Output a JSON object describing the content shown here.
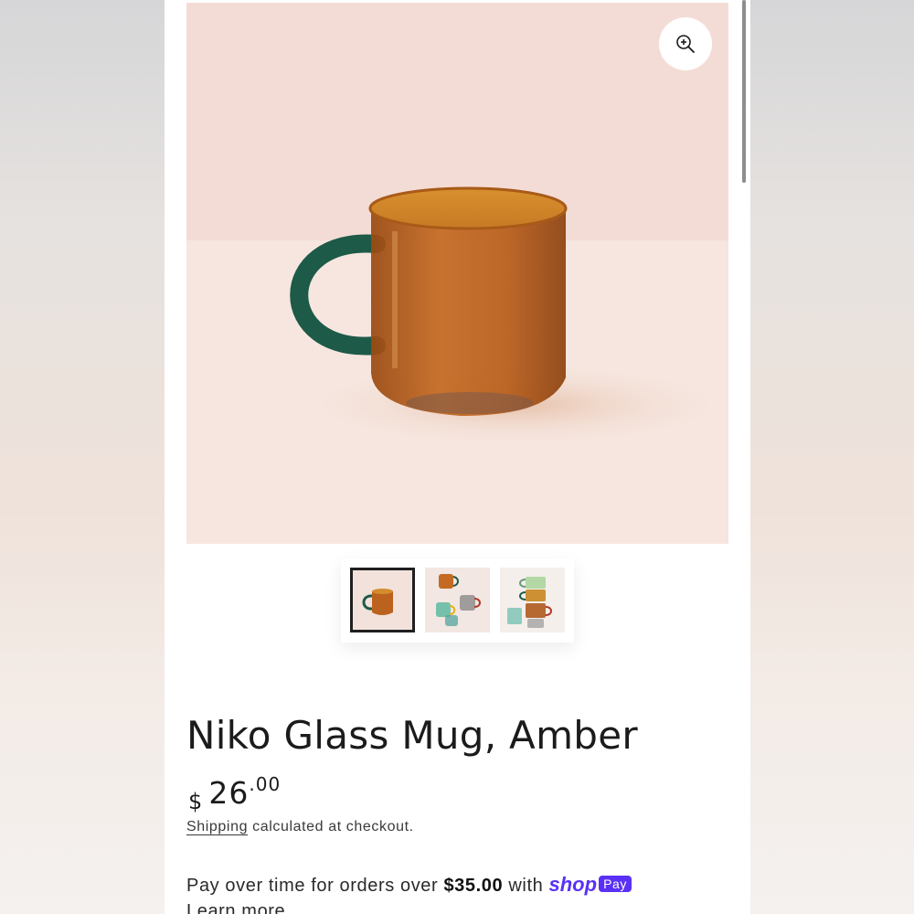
{
  "gallery": {
    "zoom_icon": "zoom-in-icon",
    "thumbnails": [
      {
        "name": "amber-mug-thumb",
        "active": true
      },
      {
        "name": "mugs-group-thumb",
        "active": false
      },
      {
        "name": "mugs-stacked-thumb",
        "active": false
      }
    ]
  },
  "product": {
    "title": "Niko Glass Mug, Amber",
    "price_currency": "$",
    "price_main": "26",
    "price_cents": ".00",
    "shipping_link": "Shipping",
    "shipping_text": " calculated at checkout."
  },
  "payment": {
    "text_before": "Pay over time for orders over ",
    "threshold": "$35.00",
    "text_after": " with ",
    "brand_shop": "shop",
    "brand_pay": "Pay",
    "learn_more": "Learn more",
    "brand_color": "#5a31f4"
  },
  "colors": {
    "amber": "#b3581a",
    "handle_green": "#1f5c4a"
  }
}
